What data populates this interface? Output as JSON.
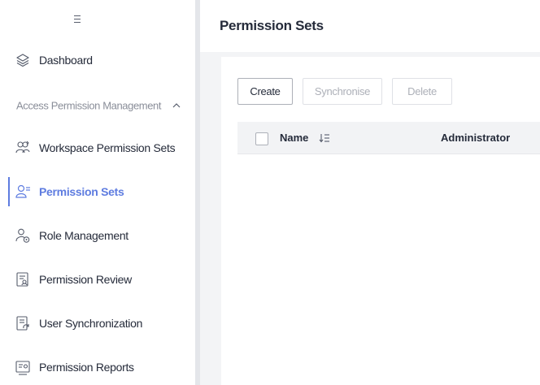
{
  "sidebar": {
    "items_top": [
      {
        "label": "Dashboard",
        "icon": "layers-icon"
      }
    ],
    "group": {
      "label": "Access Permission Management",
      "expanded": true
    },
    "items": [
      {
        "label": "Workspace Permission Sets",
        "icon": "workspace-permission-icon"
      },
      {
        "label": "Permission Sets",
        "icon": "permission-sets-icon",
        "active": true
      },
      {
        "label": "Role Management",
        "icon": "role-management-icon"
      },
      {
        "label": "Permission Review",
        "icon": "permission-review-icon"
      },
      {
        "label": "User Synchronization",
        "icon": "user-sync-icon"
      },
      {
        "label": "Permission Reports",
        "icon": "permission-reports-icon"
      }
    ]
  },
  "main": {
    "title": "Permission Sets",
    "toolbar": {
      "create_label": "Create",
      "sync_label": "Synchronise",
      "delete_label": "Delete"
    },
    "table": {
      "columns": [
        "Name",
        "Administrator"
      ],
      "rows": []
    }
  },
  "colors": {
    "accent": "#5e7ce0",
    "text": "#252b3a",
    "muted": "#8a8e99",
    "background": "#f3f4f6"
  }
}
